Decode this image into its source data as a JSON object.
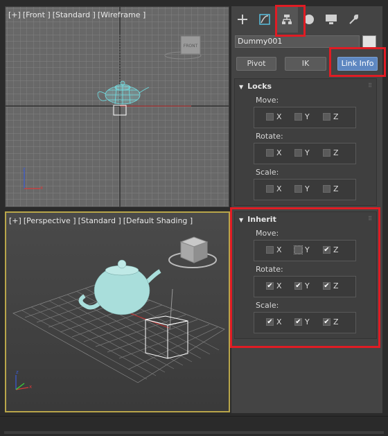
{
  "viewports": {
    "front": {
      "label": [
        "[+]",
        "[Front ]",
        "[Standard ]",
        "[Wireframe ]"
      ],
      "viewcube_face": "FRONT"
    },
    "perspective": {
      "label": [
        "[+]",
        "[Perspective ]",
        "[Standard ]",
        "[Default Shading ]"
      ]
    }
  },
  "command_panel": {
    "tabs": [
      {
        "icon": "plus-icon",
        "active": false
      },
      {
        "icon": "modify-icon",
        "active": false
      },
      {
        "icon": "hierarchy-icon",
        "active": true
      },
      {
        "icon": "motion-icon",
        "active": false
      },
      {
        "icon": "display-icon",
        "active": false
      },
      {
        "icon": "utilities-icon",
        "active": false
      }
    ],
    "object_name": "Dummy001",
    "object_color": "#e2e2e2",
    "mode_buttons": {
      "pivot": "Pivot",
      "ik": "IK",
      "link_info": "Link Info"
    },
    "locks": {
      "title": "Locks",
      "groups": [
        {
          "label": "Move:",
          "checks": [
            {
              "axis": "X",
              "checked": false
            },
            {
              "axis": "Y",
              "checked": false
            },
            {
              "axis": "Z",
              "checked": false
            }
          ]
        },
        {
          "label": "Rotate:",
          "checks": [
            {
              "axis": "X",
              "checked": false
            },
            {
              "axis": "Y",
              "checked": false
            },
            {
              "axis": "Z",
              "checked": false
            }
          ]
        },
        {
          "label": "Scale:",
          "checks": [
            {
              "axis": "X",
              "checked": false
            },
            {
              "axis": "Y",
              "checked": false
            },
            {
              "axis": "Z",
              "checked": false
            }
          ]
        }
      ]
    },
    "inherit": {
      "title": "Inherit",
      "groups": [
        {
          "label": "Move:",
          "checks": [
            {
              "axis": "X",
              "checked": false
            },
            {
              "axis": "Y",
              "checked": false
            },
            {
              "axis": "Z",
              "checked": true
            }
          ]
        },
        {
          "label": "Rotate:",
          "checks": [
            {
              "axis": "X",
              "checked": true
            },
            {
              "axis": "Y",
              "checked": true
            },
            {
              "axis": "Z",
              "checked": true
            }
          ]
        },
        {
          "label": "Scale:",
          "checks": [
            {
              "axis": "X",
              "checked": true
            },
            {
              "axis": "Y",
              "checked": true
            },
            {
              "axis": "Z",
              "checked": true
            }
          ]
        }
      ]
    }
  },
  "colors": {
    "highlight": "#e01c24",
    "active_button": "#5e87c1",
    "viewport_active_border": "#b9a64a",
    "teapot": "#a9dedb"
  }
}
